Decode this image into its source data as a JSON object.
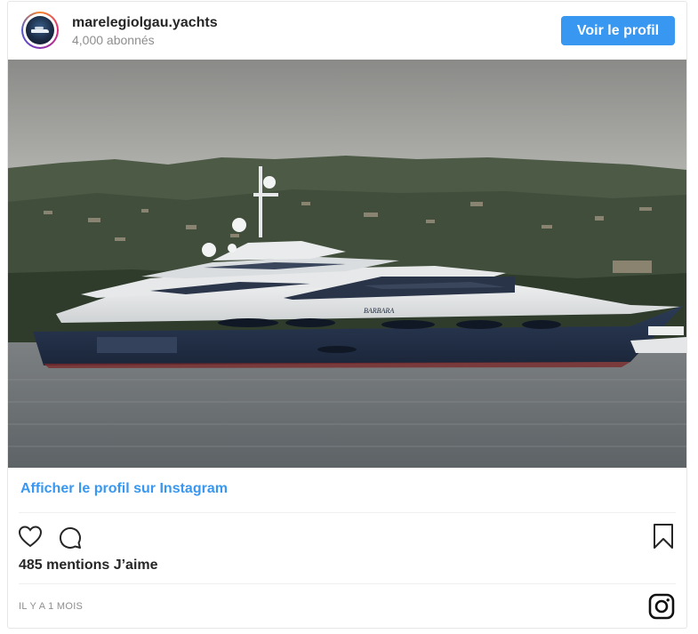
{
  "account": {
    "username": "marelegiolgau.yachts",
    "followers": "4,000 abonnés"
  },
  "header": {
    "profile_button_label": "Voir le profil"
  },
  "photo": {
    "yacht_name": "BARBARA"
  },
  "footer": {
    "view_on_instagram": "Afficher le profil sur Instagram",
    "likes": "485 mentions J’aime",
    "timestamp": "IL Y A 1 MOIS"
  },
  "icons": {
    "like": "heart-icon",
    "comment": "comment-icon",
    "save": "bookmark-icon",
    "brand": "instagram-icon"
  },
  "colors": {
    "accent": "#3897f0",
    "text": "#262626",
    "muted": "#8e8e8e"
  }
}
